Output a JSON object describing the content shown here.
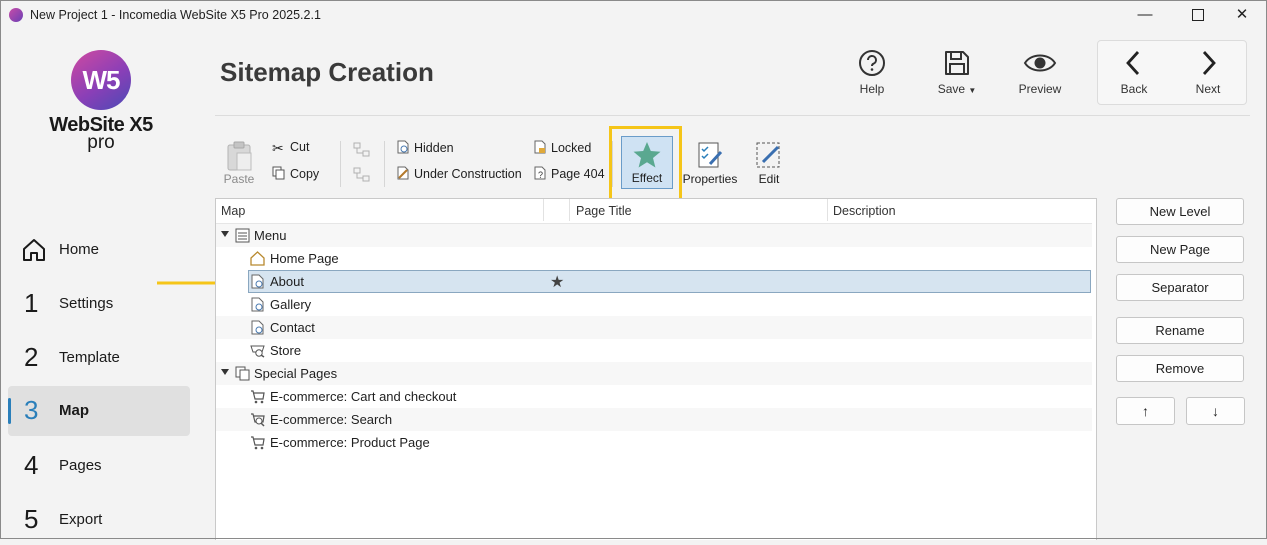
{
  "window": {
    "title": "New Project 1 - Incomedia WebSite X5 Pro 2025.2.1"
  },
  "logo": {
    "mark": "W5",
    "name": "WebSite X5",
    "edition": "pro"
  },
  "sidebar": {
    "items": [
      {
        "num": "",
        "label": "Home",
        "icon": "home-icon"
      },
      {
        "num": "1",
        "label": "Settings"
      },
      {
        "num": "2",
        "label": "Template"
      },
      {
        "num": "3",
        "label": "Map",
        "active": true
      },
      {
        "num": "4",
        "label": "Pages"
      },
      {
        "num": "5",
        "label": "Export"
      }
    ]
  },
  "header": {
    "title": "Sitemap Creation",
    "help": "Help",
    "save": "Save",
    "preview": "Preview",
    "back": "Back",
    "next": "Next"
  },
  "toolbar": {
    "paste": "Paste",
    "cut": "Cut",
    "copy": "Copy",
    "hidden": "Hidden",
    "under_construction": "Under Construction",
    "locked": "Locked",
    "page404": "Page 404",
    "effect": "Effect",
    "properties": "Properties",
    "edit": "Edit"
  },
  "tree": {
    "columns": [
      "Map",
      "Page Title",
      "Description"
    ],
    "rows": [
      {
        "label": "Menu",
        "level": 0,
        "icon": "menu-icon"
      },
      {
        "label": "Home Page",
        "level": 1,
        "icon": "home-page-icon"
      },
      {
        "label": "About",
        "level": 1,
        "icon": "page-icon",
        "selected": true,
        "effect": "★"
      },
      {
        "label": "Gallery",
        "level": 1,
        "icon": "page-icon"
      },
      {
        "label": "Contact",
        "level": 1,
        "icon": "page-icon"
      },
      {
        "label": "Store",
        "level": 1,
        "icon": "store-page-icon"
      },
      {
        "label": "Special Pages",
        "level": 0,
        "icon": "special-pages-icon"
      },
      {
        "label": "E-commerce: Cart and checkout",
        "level": 1,
        "icon": "cart-icon"
      },
      {
        "label": "E-commerce: Search",
        "level": 1,
        "icon": "search-page-icon"
      },
      {
        "label": "E-commerce: Product Page",
        "level": 1,
        "icon": "cart-icon"
      }
    ]
  },
  "actions": {
    "new_level": "New Level",
    "new_page": "New Page",
    "separator": "Separator",
    "rename": "Rename",
    "remove": "Remove",
    "move_up": "↑",
    "move_down": "↓"
  },
  "colors": {
    "accent": "#2a7fba",
    "highlight": "#f5c518",
    "selection": "#d6e4f0",
    "effect_star": "#5aa890"
  }
}
